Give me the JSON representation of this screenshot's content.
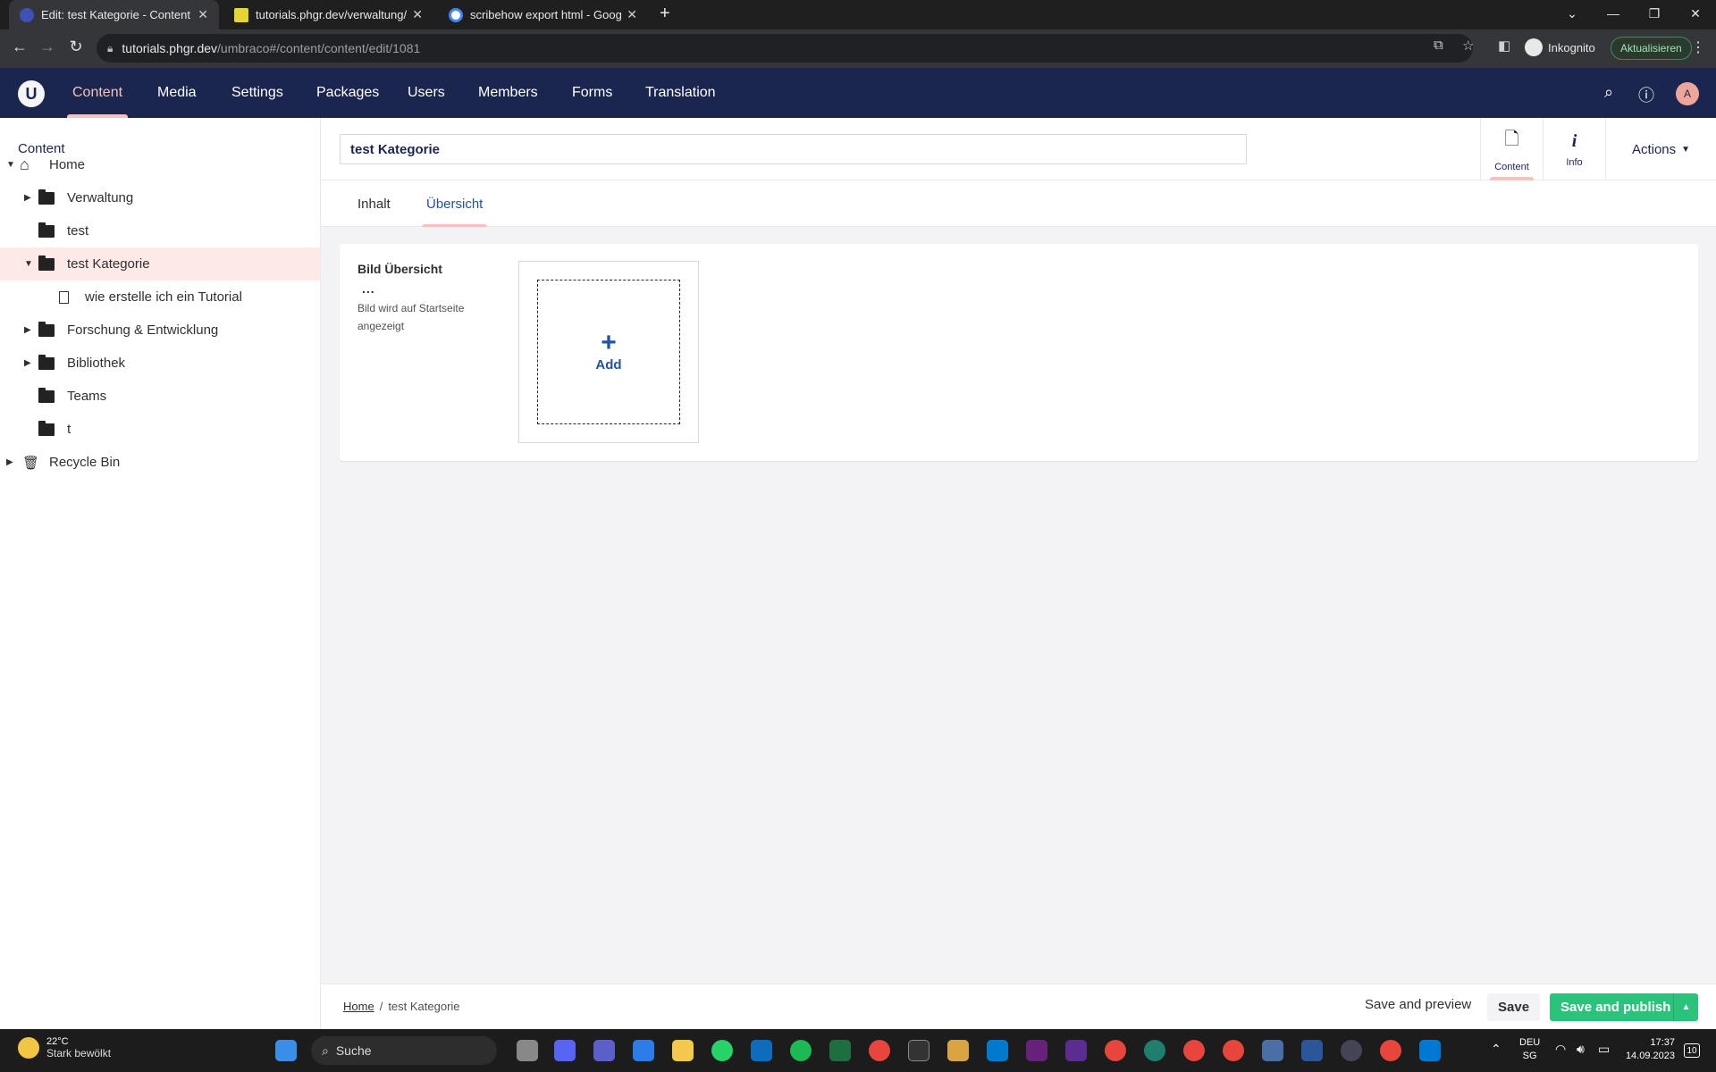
{
  "browser": {
    "tabs": [
      {
        "title": "Edit: test Kategorie - Content - tu",
        "favicon_color": "#3f51b5",
        "active": true
      },
      {
        "title": "tutorials.phgr.dev/verwaltung/inf",
        "favicon_color": "#e5d632",
        "active": false
      },
      {
        "title": "scribehow export html - Google",
        "favicon_color": "#ffffff",
        "active": false
      }
    ],
    "url_host": "tutorials.phgr.dev",
    "url_path": "/umbraco#/content/content/edit/1081",
    "incognito_label": "Inkognito",
    "update_label": "Aktualisieren"
  },
  "umbraco": {
    "logo": "U",
    "nav": [
      "Content",
      "Media",
      "Settings",
      "Packages",
      "Users",
      "Members",
      "Forms",
      "Translation"
    ],
    "active_nav": "Content",
    "avatar": "A"
  },
  "sidebar": {
    "title": "Content",
    "tree": [
      {
        "label": "Home",
        "icon": "home-icon",
        "level": 0,
        "expanded": true
      },
      {
        "label": "Verwaltung",
        "icon": "folder-icon",
        "level": 1,
        "has_children": true
      },
      {
        "label": "test",
        "icon": "folder-icon",
        "level": 1
      },
      {
        "label": "test Kategorie",
        "icon": "folder-icon",
        "level": 1,
        "expanded": true,
        "selected": true
      },
      {
        "label": "wie erstelle ich ein Tutorial",
        "icon": "document-icon",
        "level": 2
      },
      {
        "label": "Forschung & Entwicklung",
        "icon": "folder-icon",
        "level": 1,
        "has_children": true
      },
      {
        "label": "Bibliothek",
        "icon": "folder-icon",
        "level": 1,
        "has_children": true
      },
      {
        "label": "Teams",
        "icon": "folder-icon",
        "level": 1
      },
      {
        "label": "t",
        "icon": "folder-icon",
        "level": 1
      },
      {
        "label": "Recycle Bin",
        "icon": "trash-icon",
        "level": 0,
        "has_children": true
      }
    ]
  },
  "editor": {
    "name_value": "test Kategorie",
    "apps": [
      {
        "label": "Content",
        "icon": "document-icon"
      },
      {
        "label": "Info",
        "icon": "info-icon"
      }
    ],
    "actions_label": "Actions",
    "tabs": [
      "Inhalt",
      "Übersicht"
    ],
    "active_tab": "Übersicht",
    "property": {
      "label": "Bild Übersicht",
      "more": "...",
      "description": "Bild wird auf Startseite angezeigt",
      "add_label": "Add"
    }
  },
  "footer": {
    "breadcrumb_home": "Home",
    "breadcrumb_sep": "/",
    "breadcrumb_current": "test Kategorie",
    "save_preview": "Save and preview",
    "save": "Save",
    "save_publish": "Save and publish"
  },
  "colors": {
    "header_bg": "#1b264f",
    "accent_pink": "#f5c1bc",
    "publish_green": "#2bc37c",
    "link_blue": "#2152a3"
  },
  "taskbar": {
    "temperature": "22°C",
    "weather": "Stark bewölkt",
    "search_label": "Suche",
    "lang": "DEU",
    "region": "SG",
    "time": "17:37",
    "date": "14.09.2023",
    "notifications": "10"
  }
}
